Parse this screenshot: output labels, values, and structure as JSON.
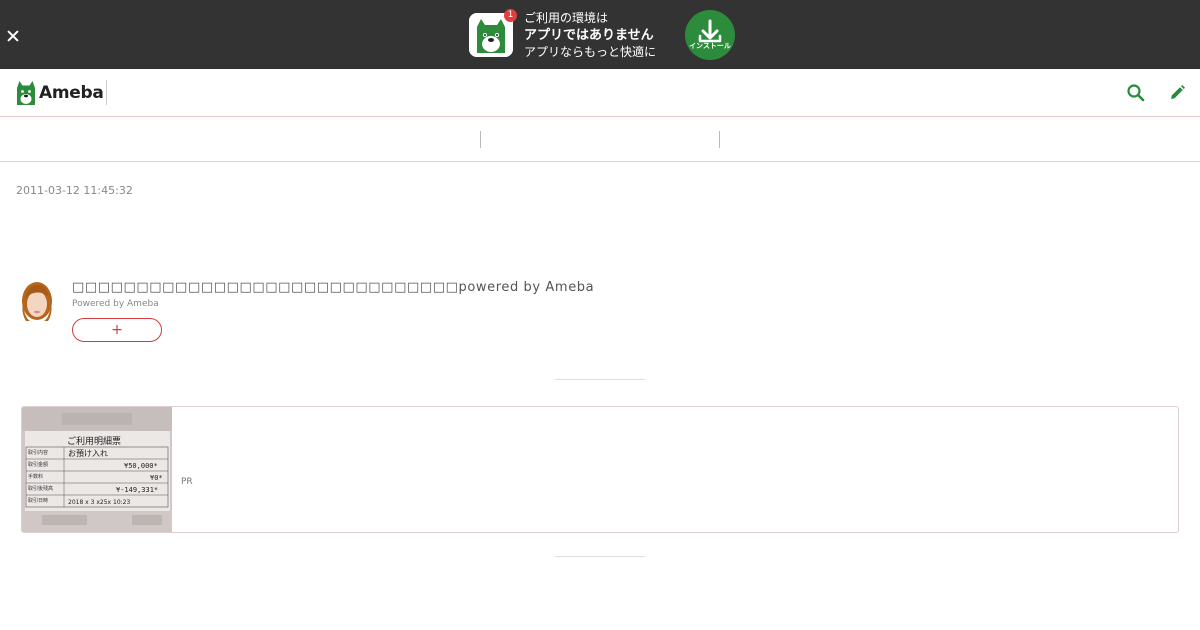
{
  "app_banner": {
    "badge_count": "1",
    "line1": "ご利用の環境は",
    "line2": "アプリではありません",
    "line3": "アプリならもっと快適に",
    "install_label": "インストール",
    "accent_color": "#2d8c3c"
  },
  "header": {
    "logo_text": "Ameba",
    "search_icon": "search-icon",
    "edit_icon": "pencil-icon",
    "accent_color": "#2a8c3a"
  },
  "article": {
    "date": "2011-03-12 11:45:32"
  },
  "blog_info": {
    "title": "□□□□□□□□□□□□□□□□□□□□□□□□□□□□□□powered by Ameba",
    "subtitle": "Powered by Ameba",
    "follow_label": "+"
  },
  "pr_card": {
    "label": "PR",
    "thumb_texts": {
      "heading": "ご利用明細票",
      "deposit": "お預け入れ",
      "amount": "¥50,000*",
      "fee": "¥0*",
      "balance": "¥-149,331*",
      "datetime": "2018 ⅹ 3 ⅹ25ⅹ 10:23",
      "row1": "取引内容",
      "row2": "取引金額",
      "row3": "手数料",
      "row4": "取引後残高",
      "row5": "取引日時"
    }
  }
}
